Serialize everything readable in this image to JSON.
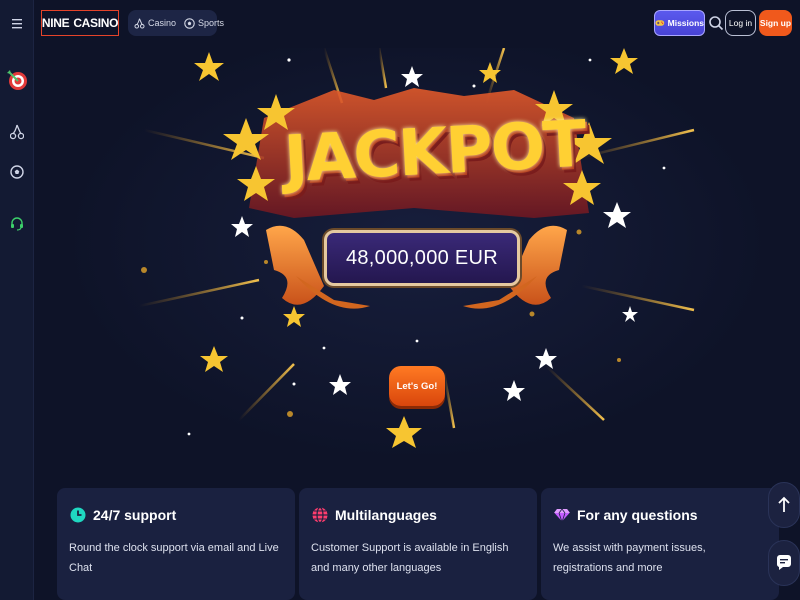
{
  "header": {
    "logo_left": "NINE",
    "logo_right": "CASINO",
    "nav": [
      {
        "label": "Casino",
        "icon": "cherries-icon"
      },
      {
        "label": "Sports",
        "icon": "soccer-ball-icon"
      }
    ],
    "missions_label": "Missions",
    "login_label": "Log in",
    "signup_label": "Sign up"
  },
  "sidebar": {
    "icons": [
      "menu-icon",
      "dart-target-icon",
      "cherries-icon",
      "soccer-ball-icon",
      "headset-icon"
    ]
  },
  "hero": {
    "title": "JACKPOT",
    "amount": "48,000,000 EUR",
    "cta_label": "Let's Go!"
  },
  "features": [
    {
      "title": "24/7 support",
      "text": "Round the clock support via email and Live Chat",
      "icon": "clock-icon",
      "icon_color": "#1fd8c1"
    },
    {
      "title": "Multilanguages",
      "text": "Customer Support is available in English and many other languages",
      "icon": "globe-icon",
      "icon_color": "#ff3d6e"
    },
    {
      "title": "For any questions",
      "text": "We assist with payment issues, registrations and more",
      "icon": "diamond-icon",
      "icon_color": "#c35cff"
    }
  ],
  "colors": {
    "background": "#0e1328",
    "accent_orange": "#f0591c",
    "missions_purple": "#5b59ee",
    "gold": "#ffd033"
  }
}
